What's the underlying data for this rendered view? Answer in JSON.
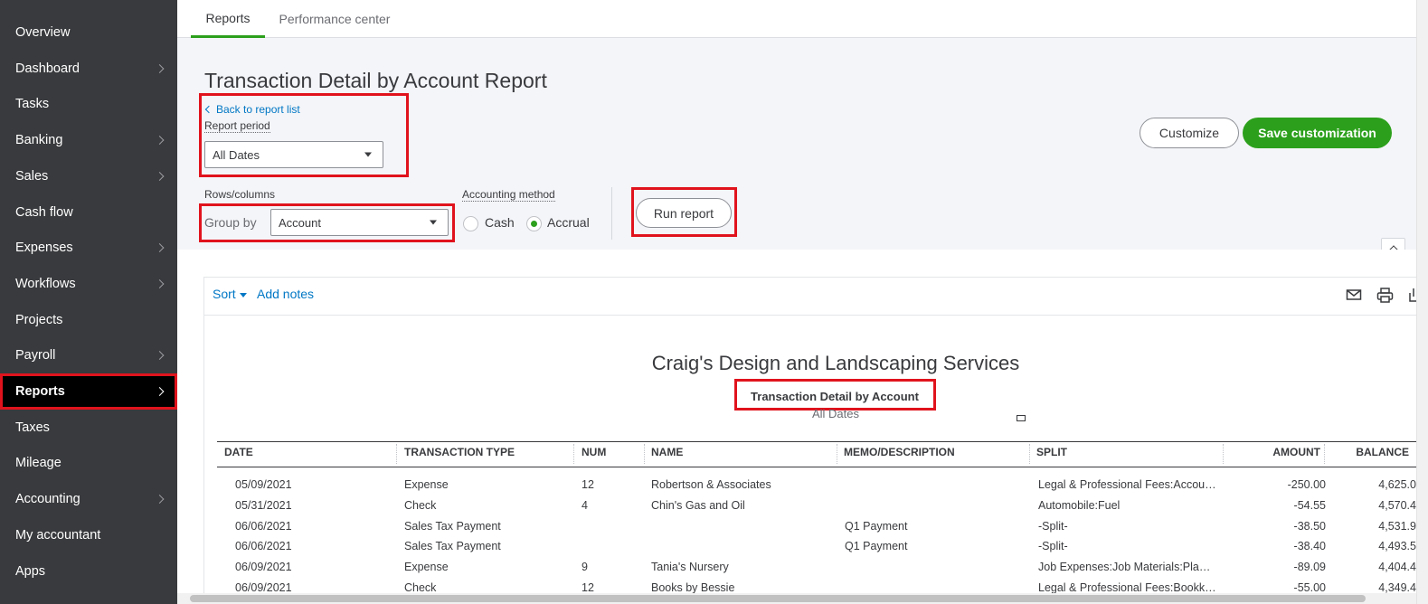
{
  "sidebar": {
    "items": [
      {
        "label": "Overview",
        "has_chevron": false
      },
      {
        "label": "Dashboard",
        "has_chevron": true
      },
      {
        "label": "Tasks",
        "has_chevron": false
      },
      {
        "label": "Banking",
        "has_chevron": true
      },
      {
        "label": "Sales",
        "has_chevron": true
      },
      {
        "label": "Cash flow",
        "has_chevron": false
      },
      {
        "label": "Expenses",
        "has_chevron": true
      },
      {
        "label": "Workflows",
        "has_chevron": true
      },
      {
        "label": "Projects",
        "has_chevron": false
      },
      {
        "label": "Payroll",
        "has_chevron": true
      },
      {
        "label": "Reports",
        "has_chevron": true,
        "active": true
      },
      {
        "label": "Taxes",
        "has_chevron": false
      },
      {
        "label": "Mileage",
        "has_chevron": false
      },
      {
        "label": "Accounting",
        "has_chevron": true
      },
      {
        "label": "My accountant",
        "has_chevron": false
      },
      {
        "label": "Apps",
        "has_chevron": false
      }
    ]
  },
  "tabs": [
    {
      "label": "Reports",
      "active": true
    },
    {
      "label": "Performance center",
      "active": false
    }
  ],
  "page": {
    "title": "Transaction Detail by Account Report",
    "back_link": "Back to report list",
    "report_period_label": "Report period",
    "report_period_value": "All Dates",
    "rows_columns_label": "Rows/columns",
    "group_by_label": "Group by",
    "group_by_value": "Account",
    "accounting_method_label": "Accounting method",
    "method_options": [
      "Cash",
      "Accrual"
    ],
    "method_selected": "Accrual",
    "run_report": "Run report",
    "customize": "Customize",
    "save_customization": "Save customization"
  },
  "report": {
    "sort_label": "Sort",
    "add_notes_label": "Add notes",
    "company": "Craig's Design and Landscaping Services",
    "title": "Transaction Detail by Account",
    "period": "All Dates",
    "columns": [
      "DATE",
      "TRANSACTION TYPE",
      "NUM",
      "NAME",
      "MEMO/DESCRIPTION",
      "SPLIT",
      "AMOUNT",
      "BALANCE"
    ],
    "rows": [
      [
        "05/09/2021",
        "Expense",
        "12",
        "Robertson & Associates",
        "",
        "Legal & Professional Fees:Accou…",
        "-250.00",
        "4,625.0"
      ],
      [
        "05/31/2021",
        "Check",
        "4",
        "Chin's Gas and Oil",
        "",
        "Automobile:Fuel",
        "-54.55",
        "4,570.4"
      ],
      [
        "06/06/2021",
        "Sales Tax Payment",
        "",
        "",
        "Q1 Payment",
        "-Split-",
        "-38.50",
        "4,531.9"
      ],
      [
        "06/06/2021",
        "Sales Tax Payment",
        "",
        "",
        "Q1 Payment",
        "-Split-",
        "-38.40",
        "4,493.5"
      ],
      [
        "06/09/2021",
        "Expense",
        "9",
        "Tania's Nursery",
        "",
        "Job Expenses:Job Materials:Pla…",
        "-89.09",
        "4,404.4"
      ],
      [
        "06/09/2021",
        "Check",
        "12",
        "Books by Bessie",
        "",
        "Legal & Professional Fees:Bookk…",
        "-55.00",
        "4,349.4"
      ]
    ]
  },
  "colors": {
    "sidebar_bg": "#393a3d",
    "active_bg": "#000000",
    "accent_green": "#2ca01c",
    "link_blue": "#0077c5",
    "highlight_red": "#e0131d"
  },
  "icons": [
    "chevron-right-icon",
    "chevron-left-icon",
    "chevron-up-icon",
    "caret-down-icon",
    "email-icon",
    "print-icon",
    "export-icon",
    "columns-icon"
  ]
}
